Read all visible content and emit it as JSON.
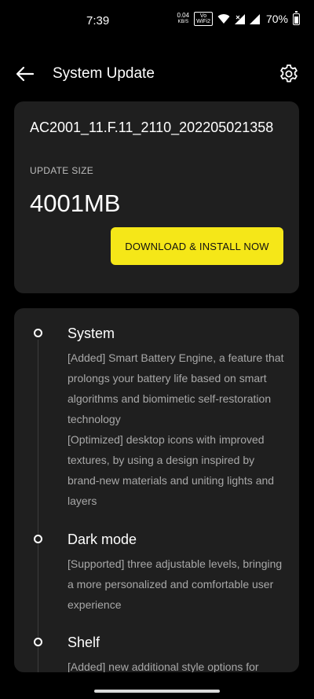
{
  "status_bar": {
    "time": "7:39",
    "net_speed_value": "0.04",
    "net_speed_unit": "KB/S",
    "volte_line1": "Vo",
    "volte_line2": "WiFi2",
    "battery_percent": "70%",
    "battery_level": 0.7
  },
  "header": {
    "title": "System Update",
    "back_icon": "arrow-left-icon",
    "settings_icon": "gear-icon"
  },
  "update_card": {
    "version": "AC2001_11.F.11_2110_202205021358",
    "size_label": "UPDATE SIZE",
    "size_value": "4001MB",
    "download_label": "DOWNLOAD & INSTALL NOW"
  },
  "notes": {
    "sections": [
      {
        "title": "System",
        "lines": [
          "[Added] Smart Battery Engine, a feature that prolongs your battery life based on smart algorithms and biomimetic self-restoration technology",
          "[Optimized] desktop icons with improved textures, by using a design inspired by brand-new materials and uniting lights and layers"
        ]
      },
      {
        "title": "Dark mode",
        "lines": [
          "[Supported] three adjustable levels, bringing a more personalized and comfortable user experience"
        ]
      },
      {
        "title": "Shelf",
        "lines": [
          "[Added] new additional style options for"
        ]
      }
    ]
  },
  "colors": {
    "background": "#000000",
    "card": "#1f1f1f",
    "accent_button": "#f5e718",
    "body_text": "#a8a8a8"
  }
}
